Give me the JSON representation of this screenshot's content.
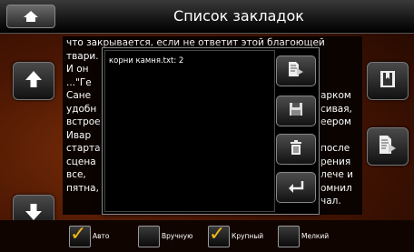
{
  "header": {
    "title": "Список закладок"
  },
  "book_text_lines": [
    "что закрывается, если не ответит этой благоющей",
    "твари.",
    "И он",
    "...\"Ге",
    "Сане",
    "удобн",
    "встрое",
    "Ивар",
    "старта",
    "сцена",
    "все,",
    "пятна,"
  ],
  "book_text_right": [
    "арком",
    "сивая,",
    "еером",
    "после",
    "рения",
    "лече и",
    "омнил",
    "чал."
  ],
  "popup": {
    "items": [
      "корни камня.txt: 2"
    ]
  },
  "options": [
    {
      "label": "Авто",
      "checked": true
    },
    {
      "label": "Вручную",
      "checked": false
    },
    {
      "label": "Крупный",
      "checked": true
    },
    {
      "label": "Мелкий",
      "checked": false
    }
  ],
  "colors": {
    "accent": "#f2b818",
    "background": "#4a1603"
  },
  "icons": {
    "home": "home-icon",
    "up": "arrow-up-icon",
    "down": "arrow-down-icon",
    "bookmark": "bookmark-icon",
    "document": "document-arrow-icon",
    "open": "document-go-icon",
    "save": "floppy-icon",
    "delete": "trash-icon",
    "back": "return-icon"
  }
}
